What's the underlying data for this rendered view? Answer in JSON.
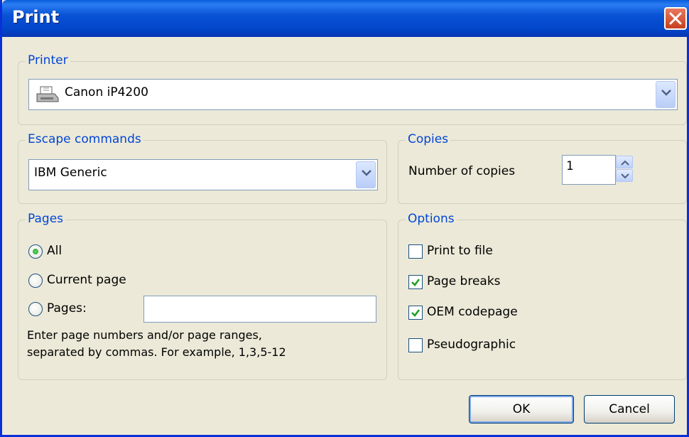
{
  "window": {
    "title": "Print"
  },
  "printer": {
    "legend": "Printer",
    "selected": "Canon iP4200",
    "icon": "printer-icon"
  },
  "escape": {
    "legend": "Escape commands",
    "selected": "IBM Generic"
  },
  "copies": {
    "legend": "Copies",
    "label": "Number of copies",
    "value": "1"
  },
  "pages": {
    "legend": "Pages",
    "options": [
      "All",
      "Current page",
      "Pages:"
    ],
    "selected": "All",
    "range_value": "",
    "help_line1": "Enter page numbers and/or page ranges,",
    "help_line2": "separated by commas. For example, 1,3,5-12"
  },
  "options": {
    "legend": "Options",
    "items": [
      {
        "label": "Print to file",
        "checked": false
      },
      {
        "label": "Page breaks",
        "checked": true
      },
      {
        "label": "OEM codepage",
        "checked": true
      },
      {
        "label": "Pseudographic",
        "checked": false
      }
    ]
  },
  "buttons": {
    "ok": "OK",
    "cancel": "Cancel"
  },
  "colors": {
    "title_bar": "#0a53d6",
    "legend": "#0046d5",
    "dialog_bg": "#ece9d8",
    "check": "#21a121"
  }
}
